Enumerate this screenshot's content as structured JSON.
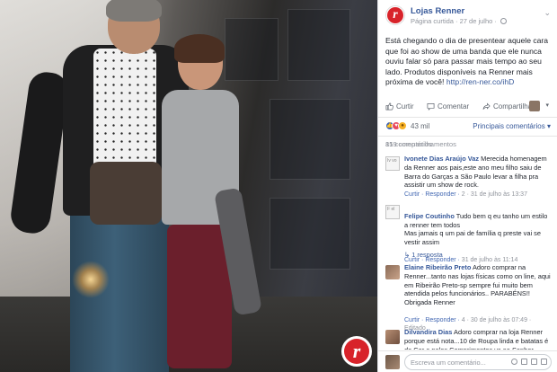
{
  "post": {
    "page_name": "Lojas Renner",
    "page_meta": "Página curtida · 27 de julho ·",
    "text_before_link": "Está chegando o dia de presentear aquele cara que foi ao show de uma banda que ele nunca ouviu falar só para passar mais tempo ao seu lado. Produtos disponíveis na Renner mais próxima de você! ",
    "link": "http://ren-ner.co/ihD",
    "logo_letter": "r"
  },
  "actions": {
    "like": "Curtir",
    "comment": "Comentar",
    "share": "Compartilhar"
  },
  "reactions": {
    "count": "43 mil",
    "sort_label": "Principais comentários ▾"
  },
  "stats": {
    "shares": "159 compartilhamentos",
    "comments": "81 comentários"
  },
  "comments": [
    {
      "avatar_text": "Iv vo",
      "author": "Ivonete Dias Araújo Vaz",
      "text": " Merecida homenagem da Renner aos pais,este ano meu filho saiu de Barra do Garças a São Paulo levar a filha pra assistir um show de rock.",
      "meta_actions": "Curtir · Responder ·",
      "meta_rest": " 2 · 31 de julho às 13:37"
    },
    {
      "avatar_text": "F el",
      "author": "Felipe Coutinho",
      "text": " Tudo bem q eu tanho um estilo a renner tem todos\nMas jamais q um pai de família q preste vai se vestir assim",
      "meta_actions": "Curtir · Responder ·",
      "meta_rest": " 31 de julho às 11:14"
    },
    {
      "author": "Elaine Ribeirão Preto",
      "text": " Adoro comprar na Renner...tanto nas lojas físicas como on line, aqui em Ribeirão Preto-sp sempre fui muito bem atendida pelos funcionários.. PARABÉNS!! Obrigada Renner",
      "meta_actions": "Curtir · Responder ·",
      "meta_rest": " 4 · 30 de julho às 07:49 ·\nEditado"
    },
    {
      "author": "Dilvandira Dias",
      "text": " Adoro comprar na loja Renner porque está nota...10 de Roupa linda e batatas é de Cor e pelos Comprimentos vc ao Senhor"
    }
  ],
  "replies": {
    "felipe": "↳ 1 resposta"
  },
  "composer": {
    "placeholder": "Escreva um comentário..."
  },
  "colors": {
    "brand_red": "#d8232a",
    "link_blue": "#365899",
    "meta_gray": "#90949c"
  }
}
